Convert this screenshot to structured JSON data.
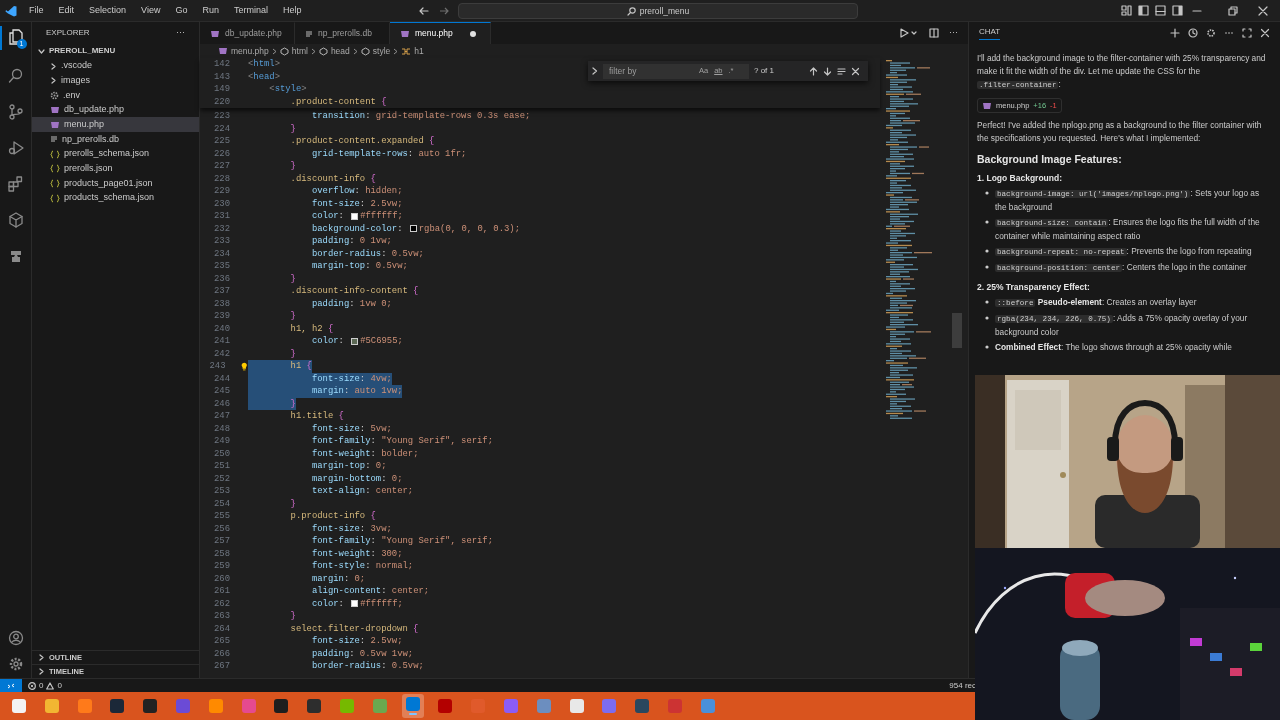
{
  "title_bar": {
    "menu": [
      "File",
      "Edit",
      "Selection",
      "View",
      "Go",
      "Run",
      "Terminal",
      "Help"
    ],
    "search": "preroll_menu"
  },
  "activity_bar": {
    "explorer_badge": "1"
  },
  "explorer": {
    "title": "EXPLORER",
    "more": "···",
    "tree": [
      {
        "label": "PREROLL_MENU",
        "kind": "root",
        "expanded": true,
        "selected": false,
        "children": [
          {
            "label": ".vscode",
            "kind": "folder",
            "expanded": false,
            "selected": false
          },
          {
            "label": "images",
            "kind": "folder",
            "expanded": false,
            "selected": false
          },
          {
            "label": ".env",
            "kind": "settings",
            "selected": false
          },
          {
            "label": "db_update.php",
            "kind": "php",
            "selected": false
          },
          {
            "label": "menu.php",
            "kind": "php",
            "selected": true
          },
          {
            "label": "np_prerolls.db",
            "kind": "db",
            "selected": false
          },
          {
            "label": "prerolls_schema.json",
            "kind": "json",
            "selected": false
          },
          {
            "label": "prerolls.json",
            "kind": "json",
            "selected": false
          },
          {
            "label": "products_page01.json",
            "kind": "json",
            "selected": false
          },
          {
            "label": "products_schema.json",
            "kind": "json",
            "selected": false
          }
        ]
      }
    ],
    "sections": [
      {
        "label": "OUTLINE",
        "expanded": false
      },
      {
        "label": "TIMELINE",
        "expanded": false
      }
    ]
  },
  "tabs": [
    {
      "label": "db_update.php",
      "kind": "php",
      "selected": false,
      "dirty": false
    },
    {
      "label": "np_prerolls.db",
      "kind": "db",
      "selected": false,
      "dirty": false
    },
    {
      "label": "menu.php",
      "kind": "php",
      "selected": true,
      "dirty": true
    }
  ],
  "breadcrumbs": [
    {
      "label": "menu.php",
      "kind": "php"
    },
    {
      "label": "html",
      "kind": "element"
    },
    {
      "label": "head",
      "kind": "element"
    },
    {
      "label": "style",
      "kind": "element"
    },
    {
      "label": "h1",
      "kind": "selector"
    }
  ],
  "find_widget": {
    "placeholder": "filter by",
    "match_case": "Aa",
    "whole_word": "ab",
    "regex": ".*",
    "result": "? of 1"
  },
  "editor": {
    "sticky_lines": [
      {
        "number": "142",
        "text": "<html>"
      },
      {
        "number": "143",
        "text": "<head>"
      },
      {
        "number": "149",
        "text": "    <style>"
      },
      {
        "number": "220",
        "text": "        .product-content {"
      }
    ],
    "lines": [
      {
        "number": "223",
        "text": "            transition: grid-template-rows 0.3s ease;",
        "selected": false,
        "lightbulb": false
      },
      {
        "number": "224",
        "text": "        }",
        "selected": false,
        "lightbulb": false
      },
      {
        "number": "225",
        "text": "        .product-content.expanded {",
        "selected": false,
        "lightbulb": false
      },
      {
        "number": "226",
        "text": "            grid-template-rows: auto 1fr;",
        "selected": false,
        "lightbulb": false
      },
      {
        "number": "227",
        "text": "        }",
        "selected": false,
        "lightbulb": false
      },
      {
        "number": "228",
        "text": "        .discount-info {",
        "selected": false,
        "lightbulb": false
      },
      {
        "number": "229",
        "text": "            overflow: hidden;",
        "selected": false,
        "lightbulb": false
      },
      {
        "number": "230",
        "text": "            font-size: 2.5vw;",
        "selected": false,
        "lightbulb": false
      },
      {
        "number": "231",
        "text": "            color: #ffffff;",
        "selected": false,
        "lightbulb": false,
        "color": "#ffffff"
      },
      {
        "number": "232",
        "text": "            background-color: rgba(0, 0, 0, 0.3);",
        "selected": false,
        "lightbulb": false,
        "color": "#000000"
      },
      {
        "number": "233",
        "text": "            padding: 0 1vw;",
        "selected": false,
        "lightbulb": false
      },
      {
        "number": "234",
        "text": "            border-radius: 0.5vw;",
        "selected": false,
        "lightbulb": false
      },
      {
        "number": "235",
        "text": "            margin-top: 0.5vw;",
        "selected": false,
        "lightbulb": false
      },
      {
        "number": "236",
        "text": "        }",
        "selected": false,
        "lightbulb": false
      },
      {
        "number": "237",
        "text": "        .discount-info-content {",
        "selected": false,
        "lightbulb": false
      },
      {
        "number": "238",
        "text": "            padding: 1vw 0;",
        "selected": false,
        "lightbulb": false
      },
      {
        "number": "239",
        "text": "        }",
        "selected": false,
        "lightbulb": false
      },
      {
        "number": "240",
        "text": "        h1, h2 {",
        "selected": false,
        "lightbulb": false
      },
      {
        "number": "241",
        "text": "            color: #5C6955;",
        "selected": false,
        "lightbulb": false,
        "color": "#5c6955"
      },
      {
        "number": "242",
        "text": "        }",
        "selected": false,
        "lightbulb": false
      },
      {
        "number": "243",
        "text": "        h1 {",
        "selected": true,
        "lightbulb": true
      },
      {
        "number": "244",
        "text": "            font-size: 4vw;",
        "selected": true,
        "lightbulb": false
      },
      {
        "number": "245",
        "text": "            margin: auto 1vw;",
        "selected": true,
        "lightbulb": false
      },
      {
        "number": "246",
        "text": "        }",
        "selected": true,
        "lightbulb": false
      },
      {
        "number": "247",
        "text": "        h1.title {",
        "selected": false,
        "lightbulb": false
      },
      {
        "number": "248",
        "text": "            font-size: 5vw;",
        "selected": false,
        "lightbulb": false
      },
      {
        "number": "249",
        "text": "            font-family: \"Young Serif\", serif;",
        "selected": false,
        "lightbulb": false
      },
      {
        "number": "250",
        "text": "            font-weight: bolder;",
        "selected": false,
        "lightbulb": false
      },
      {
        "number": "251",
        "text": "            margin-top: 0;",
        "selected": false,
        "lightbulb": false
      },
      {
        "number": "252",
        "text": "            margin-bottom: 0;",
        "selected": false,
        "lightbulb": false
      },
      {
        "number": "253",
        "text": "            text-align: center;",
        "selected": false,
        "lightbulb": false
      },
      {
        "number": "254",
        "text": "        }",
        "selected": false,
        "lightbulb": false
      },
      {
        "number": "255",
        "text": "        p.product-info {",
        "selected": false,
        "lightbulb": false
      },
      {
        "number": "256",
        "text": "            font-size: 3vw;",
        "selected": false,
        "lightbulb": false
      },
      {
        "number": "257",
        "text": "            font-family: \"Young Serif\", serif;",
        "selected": false,
        "lightbulb": false
      },
      {
        "number": "258",
        "text": "            font-weight: 300;",
        "selected": false,
        "lightbulb": false
      },
      {
        "number": "259",
        "text": "            font-style: normal;",
        "selected": false,
        "lightbulb": false
      },
      {
        "number": "260",
        "text": "            margin: 0;",
        "selected": false,
        "lightbulb": false
      },
      {
        "number": "261",
        "text": "            align-content: center;",
        "selected": false,
        "lightbulb": false
      },
      {
        "number": "262",
        "text": "            color: #ffffff;",
        "selected": false,
        "lightbulb": false,
        "color": "#ffffff"
      },
      {
        "number": "263",
        "text": "        }",
        "selected": false,
        "lightbulb": false
      },
      {
        "number": "264",
        "text": "        select.filter-dropdown {",
        "selected": false,
        "lightbulb": false
      },
      {
        "number": "265",
        "text": "            font-size: 2.5vw;",
        "selected": false,
        "lightbulb": false
      },
      {
        "number": "266",
        "text": "            padding: 0.5vw 1vw;",
        "selected": false,
        "lightbulb": false
      },
      {
        "number": "267",
        "text": "            border-radius: 0.5vw;",
        "selected": false,
        "lightbulb": false
      }
    ]
  },
  "chat": {
    "title": "CHAT",
    "blocks": [
      {
        "kind": "paragraph",
        "segments": [
          {
            "kind": "text",
            "text": "I'll add the background image to the filter-container with 25% transparency and make it fit the width of the div. Let me update the CSS for the "
          },
          {
            "kind": "code",
            "text": ".filter-container"
          },
          {
            "kind": "text",
            "text": ":"
          }
        ]
      },
      {
        "kind": "file_chip",
        "name": "menu.php",
        "added": "+16",
        "removed": "-1"
      },
      {
        "kind": "paragraph",
        "segments": [
          {
            "kind": "text",
            "text": "Perfect! I've added the nplogo.png as a background to the filter container with the specifications you requested. Here's what I implemented:"
          }
        ]
      },
      {
        "kind": "heading",
        "text": "Background Image Features:"
      },
      {
        "kind": "subheading",
        "text": "1. Logo Background:"
      },
      {
        "kind": "bullet",
        "segments": [
          {
            "kind": "code",
            "text": "background-image: url('images/nplogo.png')"
          },
          {
            "kind": "text",
            "text": ": Sets your logo as the background"
          }
        ]
      },
      {
        "kind": "bullet",
        "segments": [
          {
            "kind": "code",
            "text": "background-size: contain"
          },
          {
            "kind": "text",
            "text": ": Ensures the logo fits the full width of the container while maintaining aspect ratio"
          }
        ]
      },
      {
        "kind": "bullet",
        "segments": [
          {
            "kind": "code",
            "text": "background-repeat: no-repeat"
          },
          {
            "kind": "text",
            "text": ": Prevents the logo from repeating"
          }
        ]
      },
      {
        "kind": "bullet",
        "segments": [
          {
            "kind": "code",
            "text": "background-position: center"
          },
          {
            "kind": "text",
            "text": ": Centers the logo in the container"
          }
        ]
      },
      {
        "kind": "subheading",
        "text": "2. 25% Transparency Effect:"
      },
      {
        "kind": "bullet",
        "segments": [
          {
            "kind": "code",
            "text": "::before"
          },
          {
            "kind": "bold",
            "text": " Pseudo-element"
          },
          {
            "kind": "text",
            "text": ": Creates an overlay layer"
          }
        ]
      },
      {
        "kind": "bullet",
        "segments": [
          {
            "kind": "code",
            "text": "rgba(234, 234, 226, 0.75)"
          },
          {
            "kind": "text",
            "text": ": Adds a 75% opacity overlay of your background color"
          }
        ]
      },
      {
        "kind": "bullet",
        "segments": [
          {
            "kind": "bold",
            "text": "Combined Effect"
          },
          {
            "kind": "text",
            "text": ": The logo shows through at 25% opacity while"
          }
        ]
      }
    ]
  },
  "status_bar": {
    "errors": "0",
    "warnings": "0",
    "right": "954 rec"
  },
  "taskbar": {
    "apps": [
      {
        "selected": false
      },
      {
        "selected": false
      },
      {
        "selected": false
      },
      {
        "selected": false
      },
      {
        "selected": false
      },
      {
        "selected": false
      },
      {
        "selected": false
      },
      {
        "selected": false
      },
      {
        "selected": false
      },
      {
        "selected": false
      },
      {
        "selected": false
      },
      {
        "selected": false
      },
      {
        "selected": true
      },
      {
        "selected": false
      },
      {
        "selected": false
      },
      {
        "selected": false
      },
      {
        "selected": false
      },
      {
        "selected": false
      },
      {
        "selected": false
      },
      {
        "selected": false
      },
      {
        "selected": false
      },
      {
        "selected": false
      }
    ]
  }
}
